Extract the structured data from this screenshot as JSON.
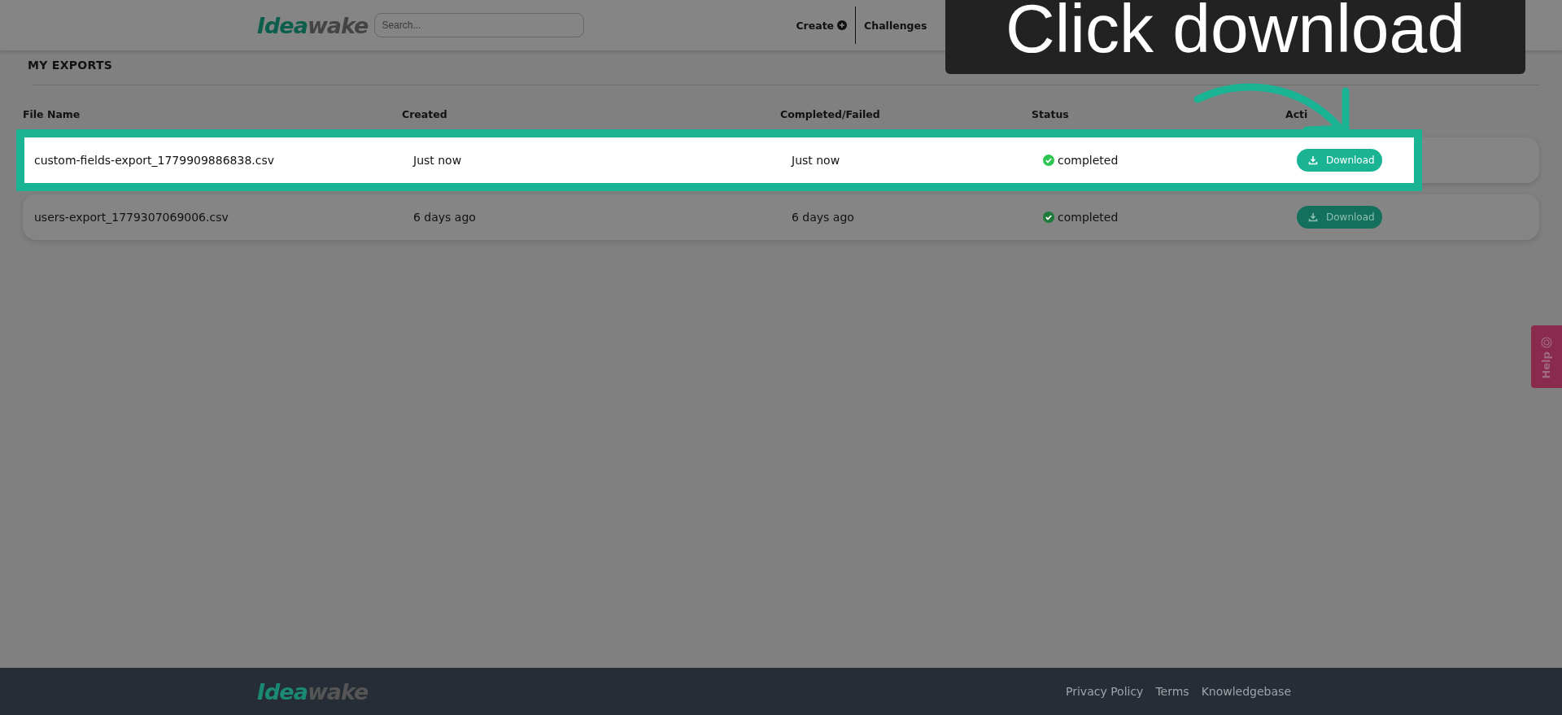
{
  "header": {
    "logo": {
      "part_1": "Idea",
      "part_2": "wake"
    },
    "search": {
      "placeholder": "Search..."
    },
    "nav": [
      {
        "label": "Create",
        "kind": "create"
      },
      {
        "label": "Challenges",
        "kind": "link"
      }
    ]
  },
  "tutorial": {
    "text": "Click download"
  },
  "page_title": "MY EXPORTS",
  "table": {
    "columns": [
      "File Name",
      "Created",
      "Completed/Failed",
      "Status",
      "Acti"
    ],
    "rows": [
      {
        "file_name": "custom-fields-export_1779909886838.csv",
        "created": "Just now",
        "completed": "Just now",
        "status": "completed",
        "action": "Download",
        "highlighted": true
      },
      {
        "file_name": "users-export_1779307069006.csv",
        "created": "6 days ago",
        "completed": "6 days ago",
        "status": "completed",
        "action": "Download",
        "highlighted": false
      }
    ]
  },
  "help_tab": {
    "label": "Help"
  },
  "footer": {
    "logo": {
      "part_1": "Idea",
      "part_2": "wake"
    },
    "links": [
      "Privacy Policy",
      "Terms",
      "Knowledgebase"
    ]
  }
}
